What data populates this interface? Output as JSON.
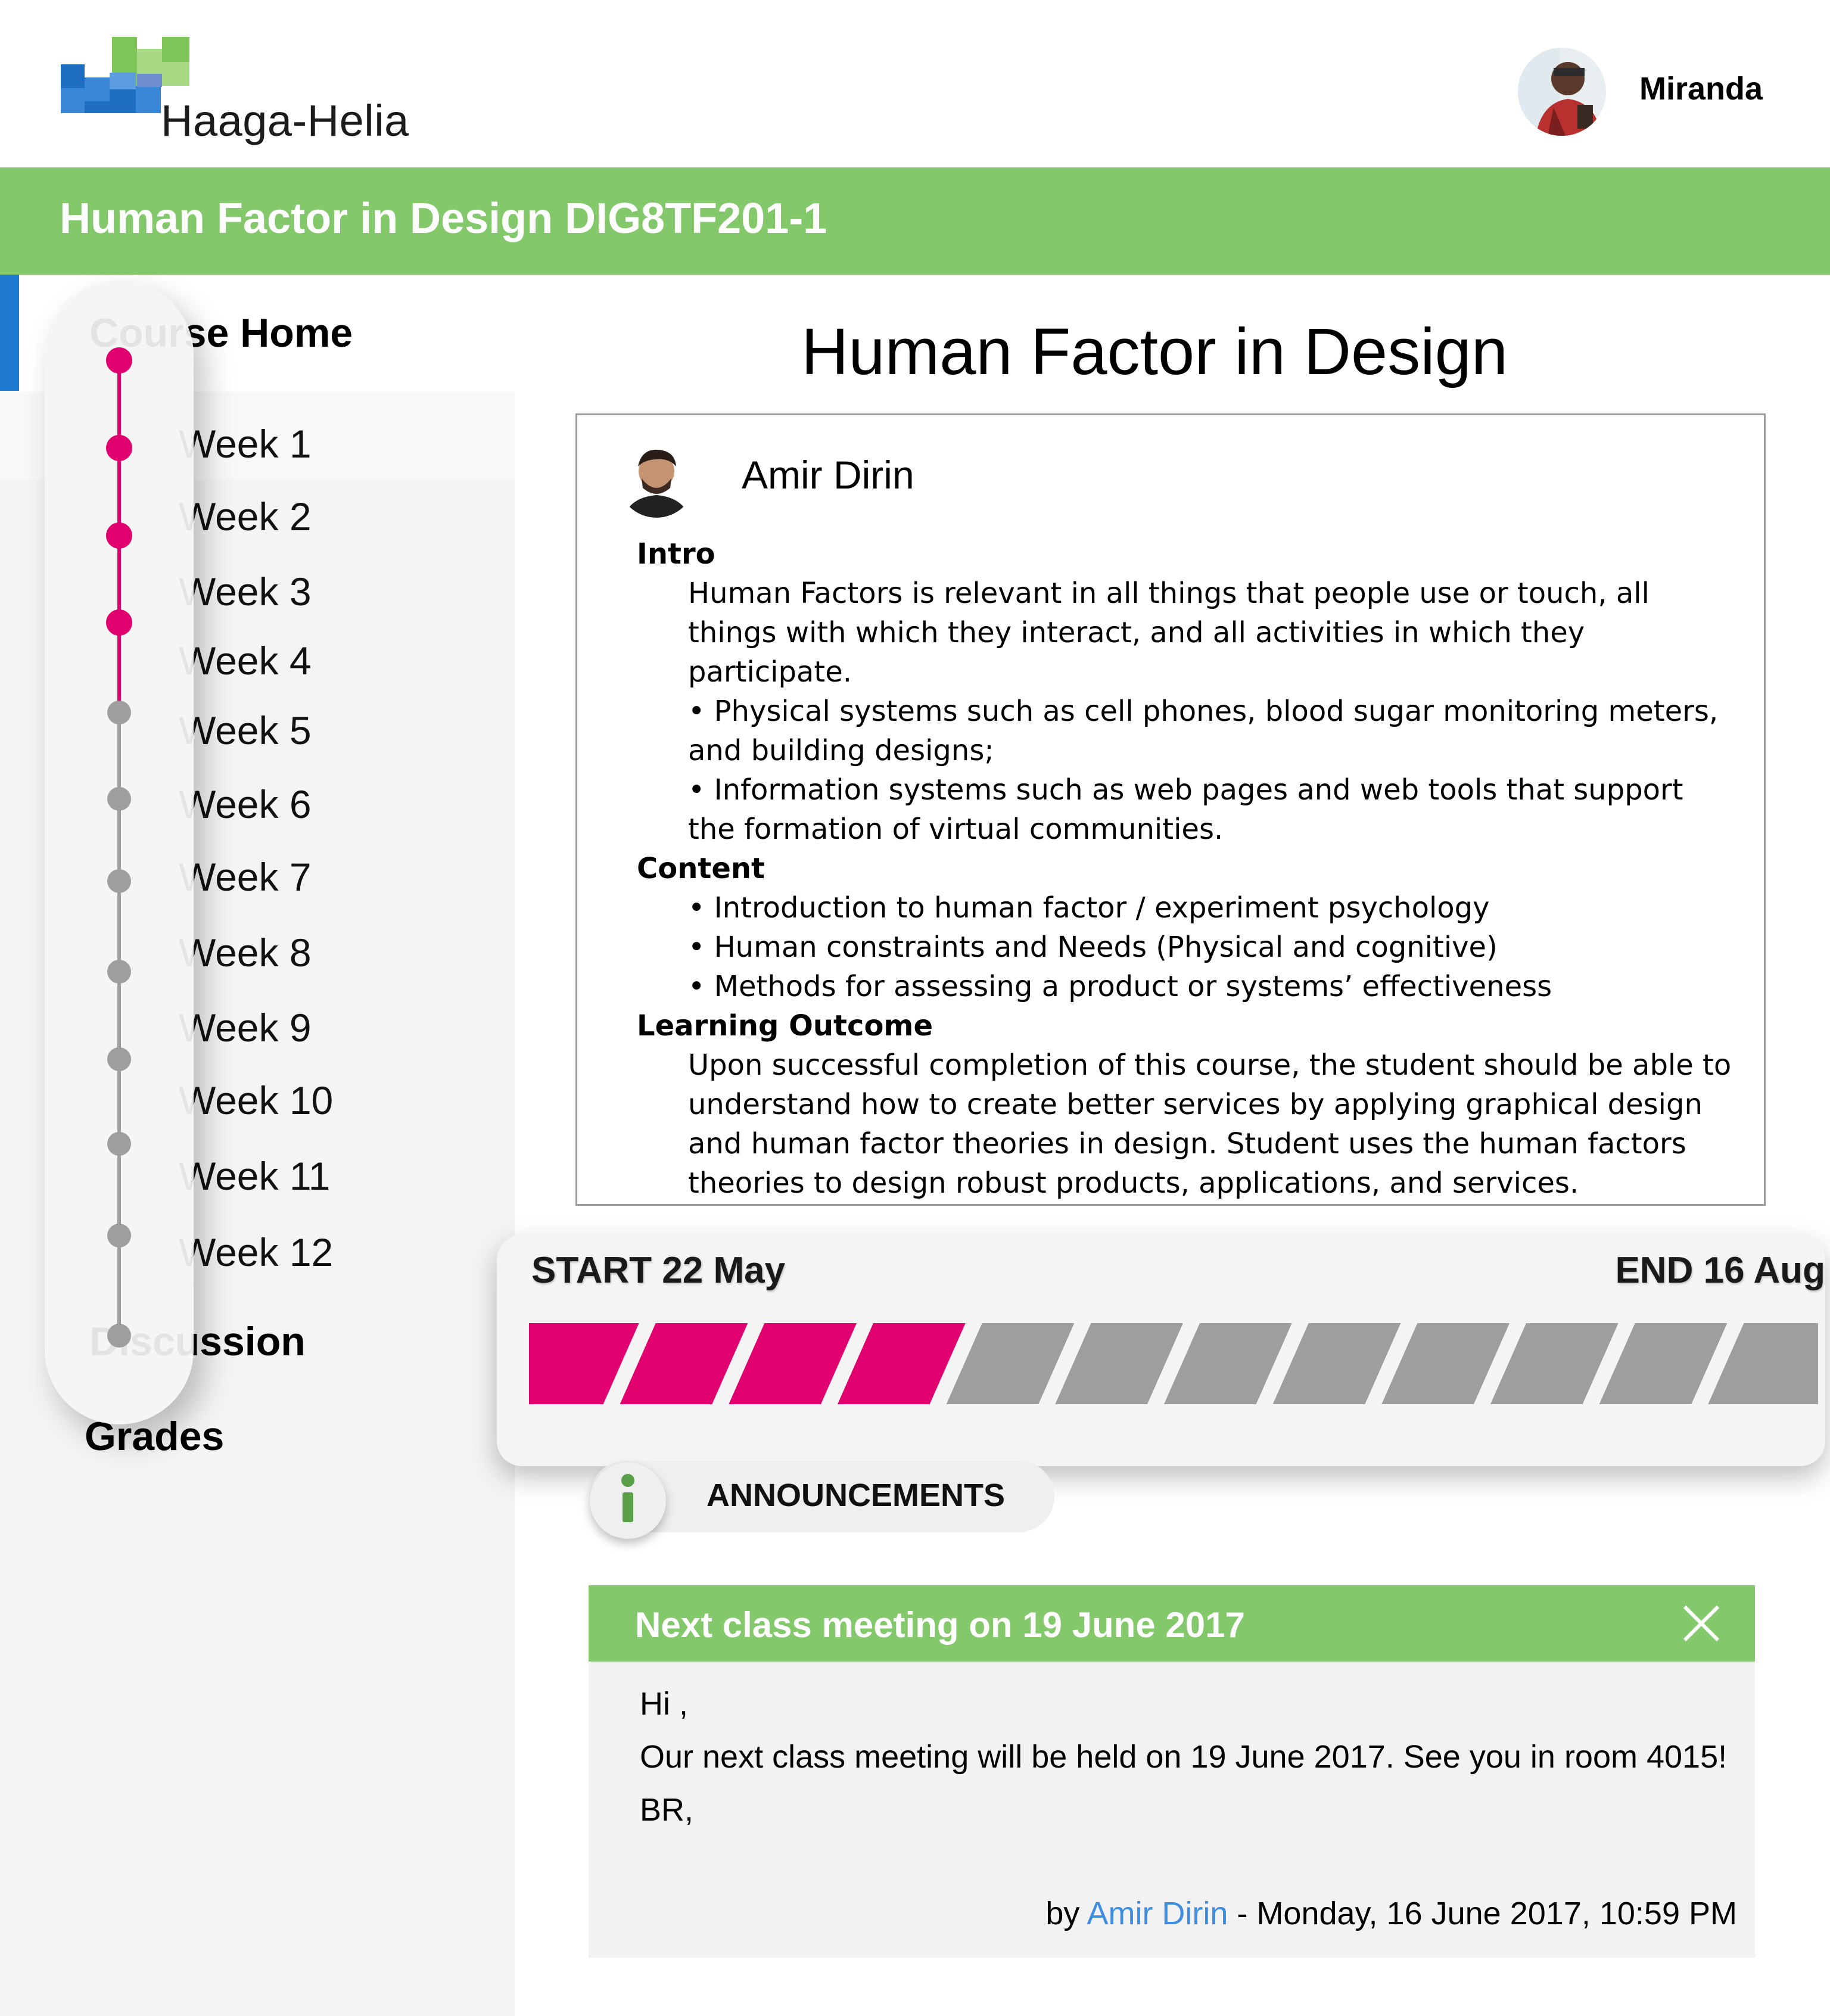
{
  "header": {
    "logo_text": "Haaga-Helia",
    "user_name": "Miranda",
    "colors": {
      "logo_blue": "#1e6fc2",
      "logo_green": "#7cc556"
    }
  },
  "course": {
    "title": "Human Factor in Design DIG8TF201-1",
    "bar_color": "#84c86c"
  },
  "sidebar": {
    "course_home": "Course Home",
    "weeks": [
      "Week 1",
      "Week 2",
      "Week 3",
      "Week 4",
      "Week 5",
      "Week 6",
      "Week 7",
      "Week 8",
      "Week 9",
      "Week 10",
      "Week 11",
      "Week 12"
    ],
    "discussion": "Discussion",
    "grades": "Grades",
    "weeks_completed": 4,
    "colors": {
      "done": "#e0006e",
      "pending": "#9e9e9e"
    }
  },
  "main": {
    "title": "Human Factor in Design",
    "teacher": "Amir Dirin",
    "sections": [
      {
        "heading": "Intro",
        "lines": [
          "Human Factors is relevant in all things that people use or touch, all things with which they interact, and all activities in which they participate.",
          "• Physical systems such as cell phones, blood sugar monitoring meters, and building designs;",
          "• Information systems such as web pages and web tools that support the formation of virtual communities."
        ]
      },
      {
        "heading": "Content",
        "lines": [
          "• Introduction to human factor / experiment psychology",
          "• Human constraints and Needs (Physical and cognitive)",
          "• Methods for assessing a product or systems’ effectiveness"
        ]
      },
      {
        "heading": "Learning Outcome",
        "lines": [
          "Upon successful completion of this course, the student should be able to understand how to create better services by applying graphical design and human factor theories in design. Student uses the human factors theories to design robust products, applications, and services."
        ]
      }
    ]
  },
  "progress": {
    "start": "START 22 May",
    "end": "END 16 Aug",
    "total_segments": 12,
    "completed_segments": 4
  },
  "announcements": {
    "label": "ANNOUNCEMENTS",
    "icon": "info-icon",
    "card": {
      "title": "Next class meeting on 19 June 2017",
      "greeting": "Hi ,",
      "body": "Our next class meeting will be held on 19 June 2017. See you in room 4015!",
      "signoff": "BR,",
      "by": "by",
      "author": "Amir Dirin",
      "date": " - Monday, 16 June 2017, 10:59 PM"
    }
  }
}
